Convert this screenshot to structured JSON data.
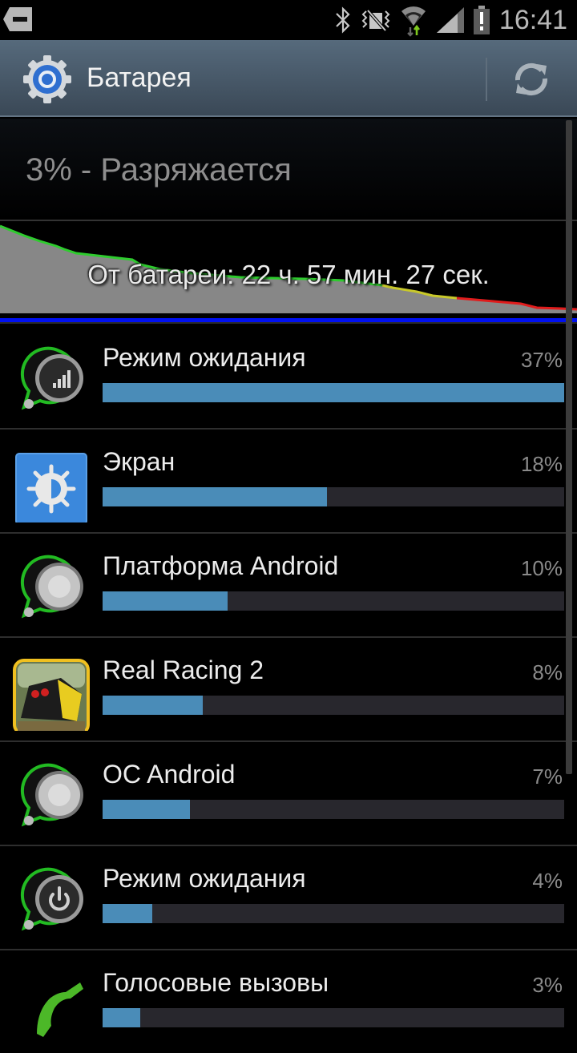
{
  "status_bar": {
    "time": "16:41",
    "icons": [
      "notification-icon",
      "bluetooth-icon",
      "vibrate-mute-icon",
      "wifi-icon",
      "signal-icon",
      "battery-alert-icon"
    ]
  },
  "action_bar": {
    "title": "Батарея",
    "app_icon": "settings-gear-icon",
    "refresh_icon": "refresh-icon"
  },
  "summary": {
    "status_text": "3% - Разряжается"
  },
  "graph": {
    "label": "От батареи: 22 ч. 57 мин. 27 сек.",
    "colors": {
      "fill": "#878787",
      "good": "#2ecc2e",
      "medium": "#c8c82a",
      "low": "#e01c1c"
    }
  },
  "usage": {
    "max_percent": 37,
    "bar_color": "#4a8cb8",
    "track_color": "#28272d",
    "items": [
      {
        "label": "Режим ожидания",
        "percent": 37,
        "percent_text": "37%",
        "icon": "cell-standby-icon"
      },
      {
        "label": "Экран",
        "percent": 18,
        "percent_text": "18%",
        "icon": "screen-brightness-icon"
      },
      {
        "label": "Платформа Android",
        "percent": 10,
        "percent_text": "10%",
        "icon": "android-platform-icon"
      },
      {
        "label": "Real Racing 2",
        "percent": 8,
        "percent_text": "8%",
        "icon": "real-racing-2-app-icon"
      },
      {
        "label": "OC Android",
        "percent": 7,
        "percent_text": "7%",
        "icon": "android-os-icon"
      },
      {
        "label": "Режим ожидания",
        "percent": 4,
        "percent_text": "4%",
        "icon": "power-idle-icon"
      },
      {
        "label": "Голосовые вызовы",
        "percent": 3,
        "percent_text": "3%",
        "icon": "phone-call-icon"
      }
    ]
  }
}
